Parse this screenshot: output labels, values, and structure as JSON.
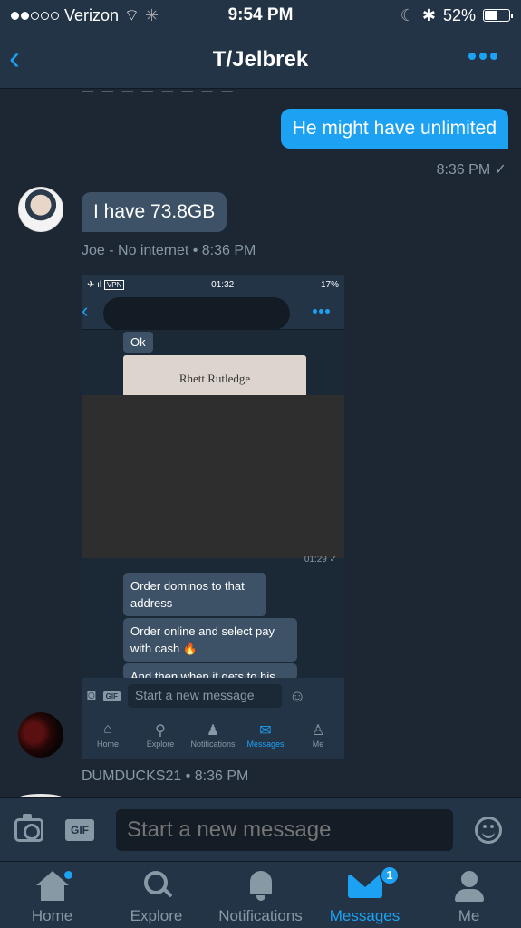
{
  "status_bar": {
    "carrier": "Verizon",
    "time": "9:54 PM",
    "battery": "52%",
    "battery_level": 0.52
  },
  "nav": {
    "title": "T/Jelbrek"
  },
  "messages": {
    "outgoing_text": "He might have unlimited",
    "outgoing_time": "8:36 PM ✓",
    "incoming_text": "I have 73.8GB",
    "incoming_meta": "Joe - No internet • 8:36 PM",
    "second_sender_meta": "DUMDUCKS21 • 8:36 PM"
  },
  "embedded_screenshot": {
    "status_vpn": "VPN",
    "status_time": "01:32",
    "status_battery": "17%",
    "ok_text": "Ok",
    "photo_text": "Rhett Rutledge",
    "photo_time": "01:29 ✓",
    "bubble1": "Order dominos to that address",
    "bubble2": "Order online and select pay with cash 🔥",
    "bubble3": "And then when it gets to his",
    "compose_placeholder": "Start a new message",
    "tabs": [
      "Home",
      "Explore",
      "Notifications",
      "Messages",
      "Me"
    ]
  },
  "compose": {
    "gif_label": "GIF",
    "placeholder": "Start a new message"
  },
  "tabbar": {
    "home": "Home",
    "explore": "Explore",
    "notifications": "Notifications",
    "messages": "Messages",
    "me": "Me",
    "messages_badge": "1"
  },
  "colors": {
    "accent": "#1da1f2",
    "background": "#1c2733",
    "bar": "#243447",
    "muted": "#8899a6"
  }
}
